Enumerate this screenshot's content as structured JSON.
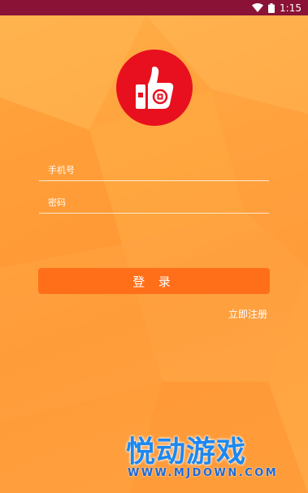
{
  "status_bar": {
    "time": "1:15",
    "icons": [
      "wifi-icon",
      "battery-icon"
    ]
  },
  "app_logo": {
    "icon": "thumbs-up-icon",
    "color": "#e8101e"
  },
  "login_form": {
    "phone_placeholder": "手机号",
    "password_placeholder": "密码",
    "login_label": "登 录",
    "register_link": "立即注册"
  },
  "watermark": {
    "title": "悦动游戏",
    "subtitle": "WWW.MJDOWN.COM"
  },
  "colors": {
    "status_bar": "#8a1236",
    "background": "#ffa23c",
    "button": "#ff6f1a",
    "watermark": "#1e88f0"
  }
}
